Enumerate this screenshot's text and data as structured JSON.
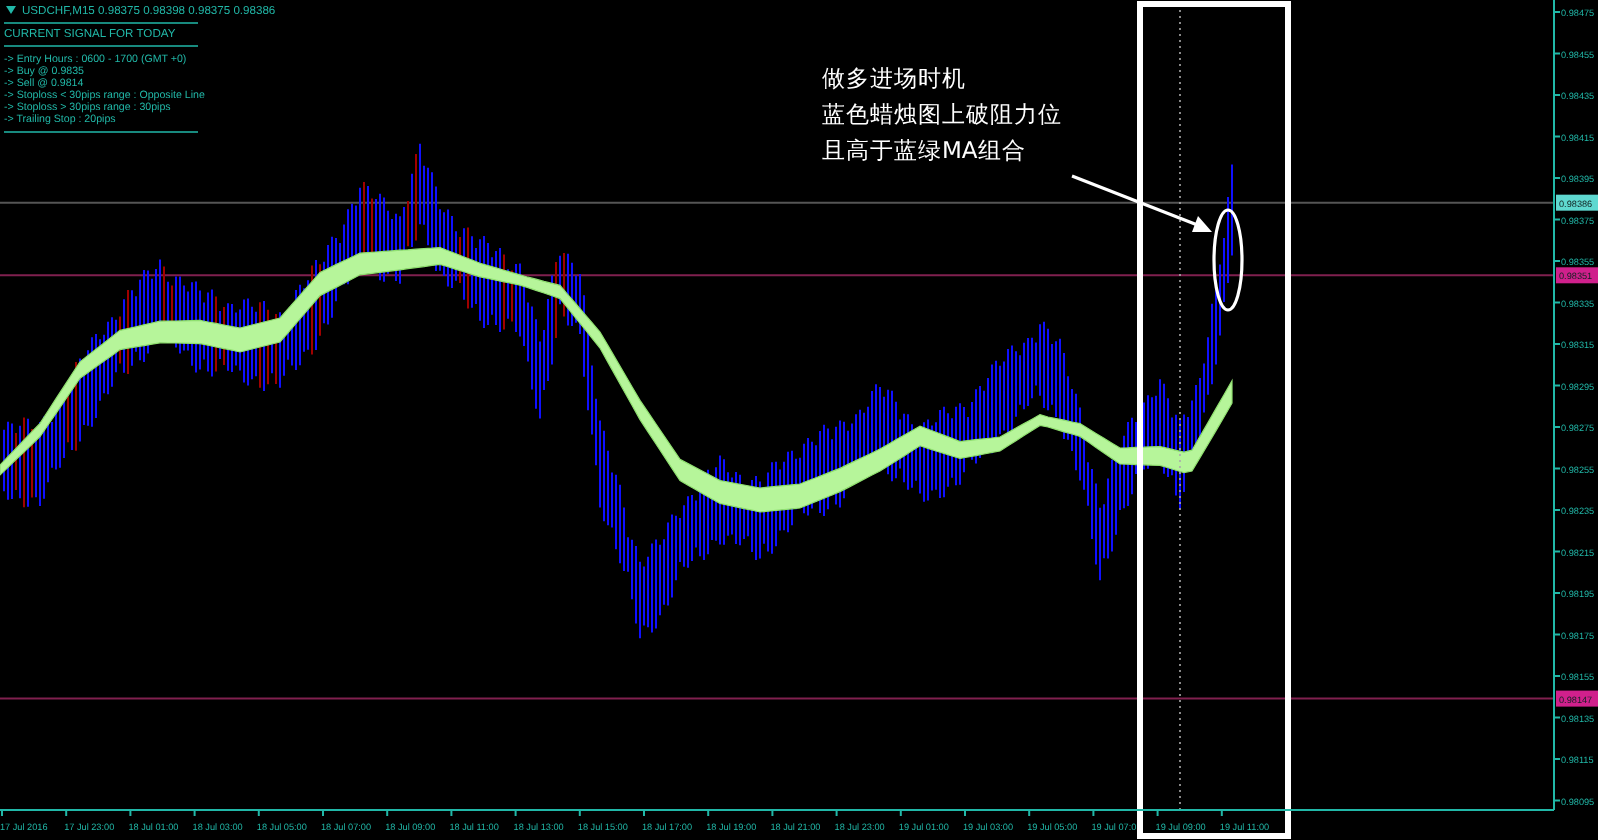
{
  "chart": {
    "header": "USDCHF,M15  0.98375 0.98398 0.98375 0.98386",
    "signal_panel": {
      "title": "CURRENT SIGNAL FOR TODAY",
      "lines": [
        "-> Entry Hours : 0600 - 1700 (GMT +0)",
        "-> Buy @ 0.9835",
        "-> Sell @ 0.9814",
        "-> Stoploss < 30pips range : Opposite Line",
        "-> Stoploss > 30pips range : 30pips",
        "-> Trailing Stop : 20pips"
      ]
    },
    "price_axis": {
      "ticks": [
        "0.98475",
        "0.98455",
        "0.98435",
        "0.98415",
        "0.98395",
        "0.98375",
        "0.98355",
        "0.98335",
        "0.98315",
        "0.98295",
        "0.98275",
        "0.98255",
        "0.98235",
        "0.98215",
        "0.98195",
        "0.98175",
        "0.98155",
        "0.98135",
        "0.98115",
        "0.98095"
      ],
      "markers": [
        {
          "label": "0.98386",
          "color": "#5fd8d0"
        },
        {
          "label": "0.98351",
          "color": "#d0208c"
        },
        {
          "label": "0.98147",
          "color": "#d0208c"
        }
      ]
    },
    "time_axis": {
      "labels": [
        "17 Jul 2016",
        "17 Jul 23:00",
        "18 Jul 01:00",
        "18 Jul 03:00",
        "18 Jul 05:00",
        "18 Jul 07:00",
        "18 Jul 09:00",
        "18 Jul 11:00",
        "18 Jul 13:00",
        "18 Jul 15:00",
        "18 Jul 17:00",
        "18 Jul 19:00",
        "18 Jul 21:00",
        "18 Jul 23:00",
        "19 Jul 01:00",
        "19 Jul 03:00",
        "19 Jul 05:00",
        "19 Jul 07:0",
        "19 Jul 09:00",
        "19 Jul 11:00"
      ]
    },
    "annotation": {
      "lines": [
        "做多进场时机",
        "蓝色蜡烛图上破阻力位",
        "且高于蓝绿MA组合"
      ]
    }
  }
}
